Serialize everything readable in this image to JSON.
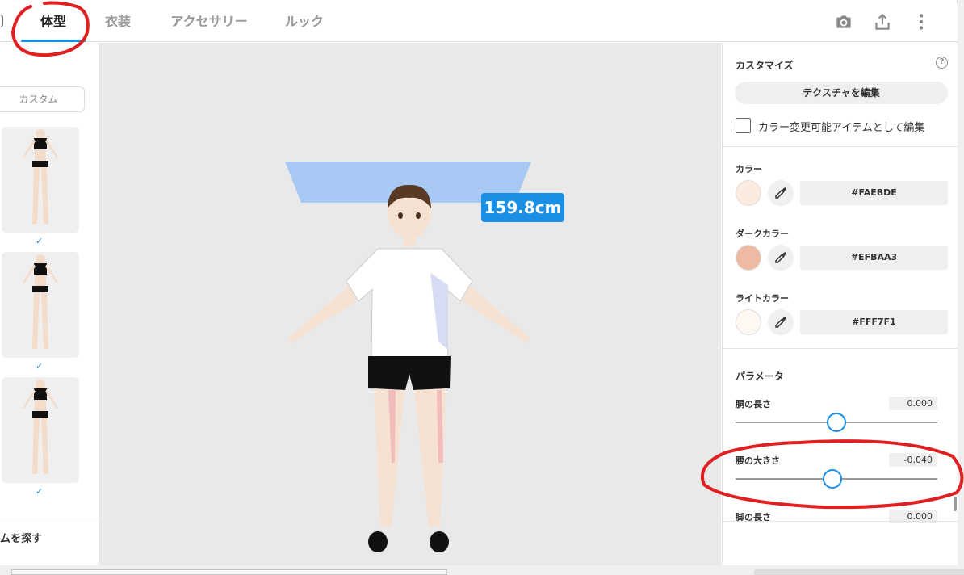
{
  "tabs": [
    {
      "label": "体型",
      "active": true
    },
    {
      "label": "衣装",
      "active": false
    },
    {
      "label": "アクセサリー",
      "active": false
    },
    {
      "label": "ルック",
      "active": false
    }
  ],
  "header_icons": [
    "camera-icon",
    "share-icon",
    "more-vert-icon"
  ],
  "left_panel": {
    "custom_button": "カスタム",
    "presets_selected": [
      true,
      true,
      true
    ],
    "check_mark": "✓",
    "find_text": "ムを探す"
  },
  "viewport": {
    "height_label": "159.8cm"
  },
  "customize": {
    "title": "カスタマイズ",
    "help_icon": "?",
    "texture_button": "テクスチャを編集",
    "checkbox_label": "カラー変更可能アイテムとして編集",
    "checkbox_checked": false
  },
  "colors": [
    {
      "label": "カラー",
      "hex": "#FAEBDE"
    },
    {
      "label": "ダークカラー",
      "hex": "#EFBAA3"
    },
    {
      "label": "ライトカラー",
      "hex": "#FFF7F1"
    }
  ],
  "parameters": {
    "title": "パラメータ",
    "items": [
      {
        "label": "胴の長さ",
        "value": "0.000",
        "position": 0.5
      },
      {
        "label": "腰の大きさ",
        "value": "-0.040",
        "position": 0.48
      },
      {
        "label": "脚の長さ",
        "value": "0.000",
        "position": 0.5
      }
    ]
  },
  "accent_color": "#1A8FE3",
  "annotation_color": "#E02020"
}
